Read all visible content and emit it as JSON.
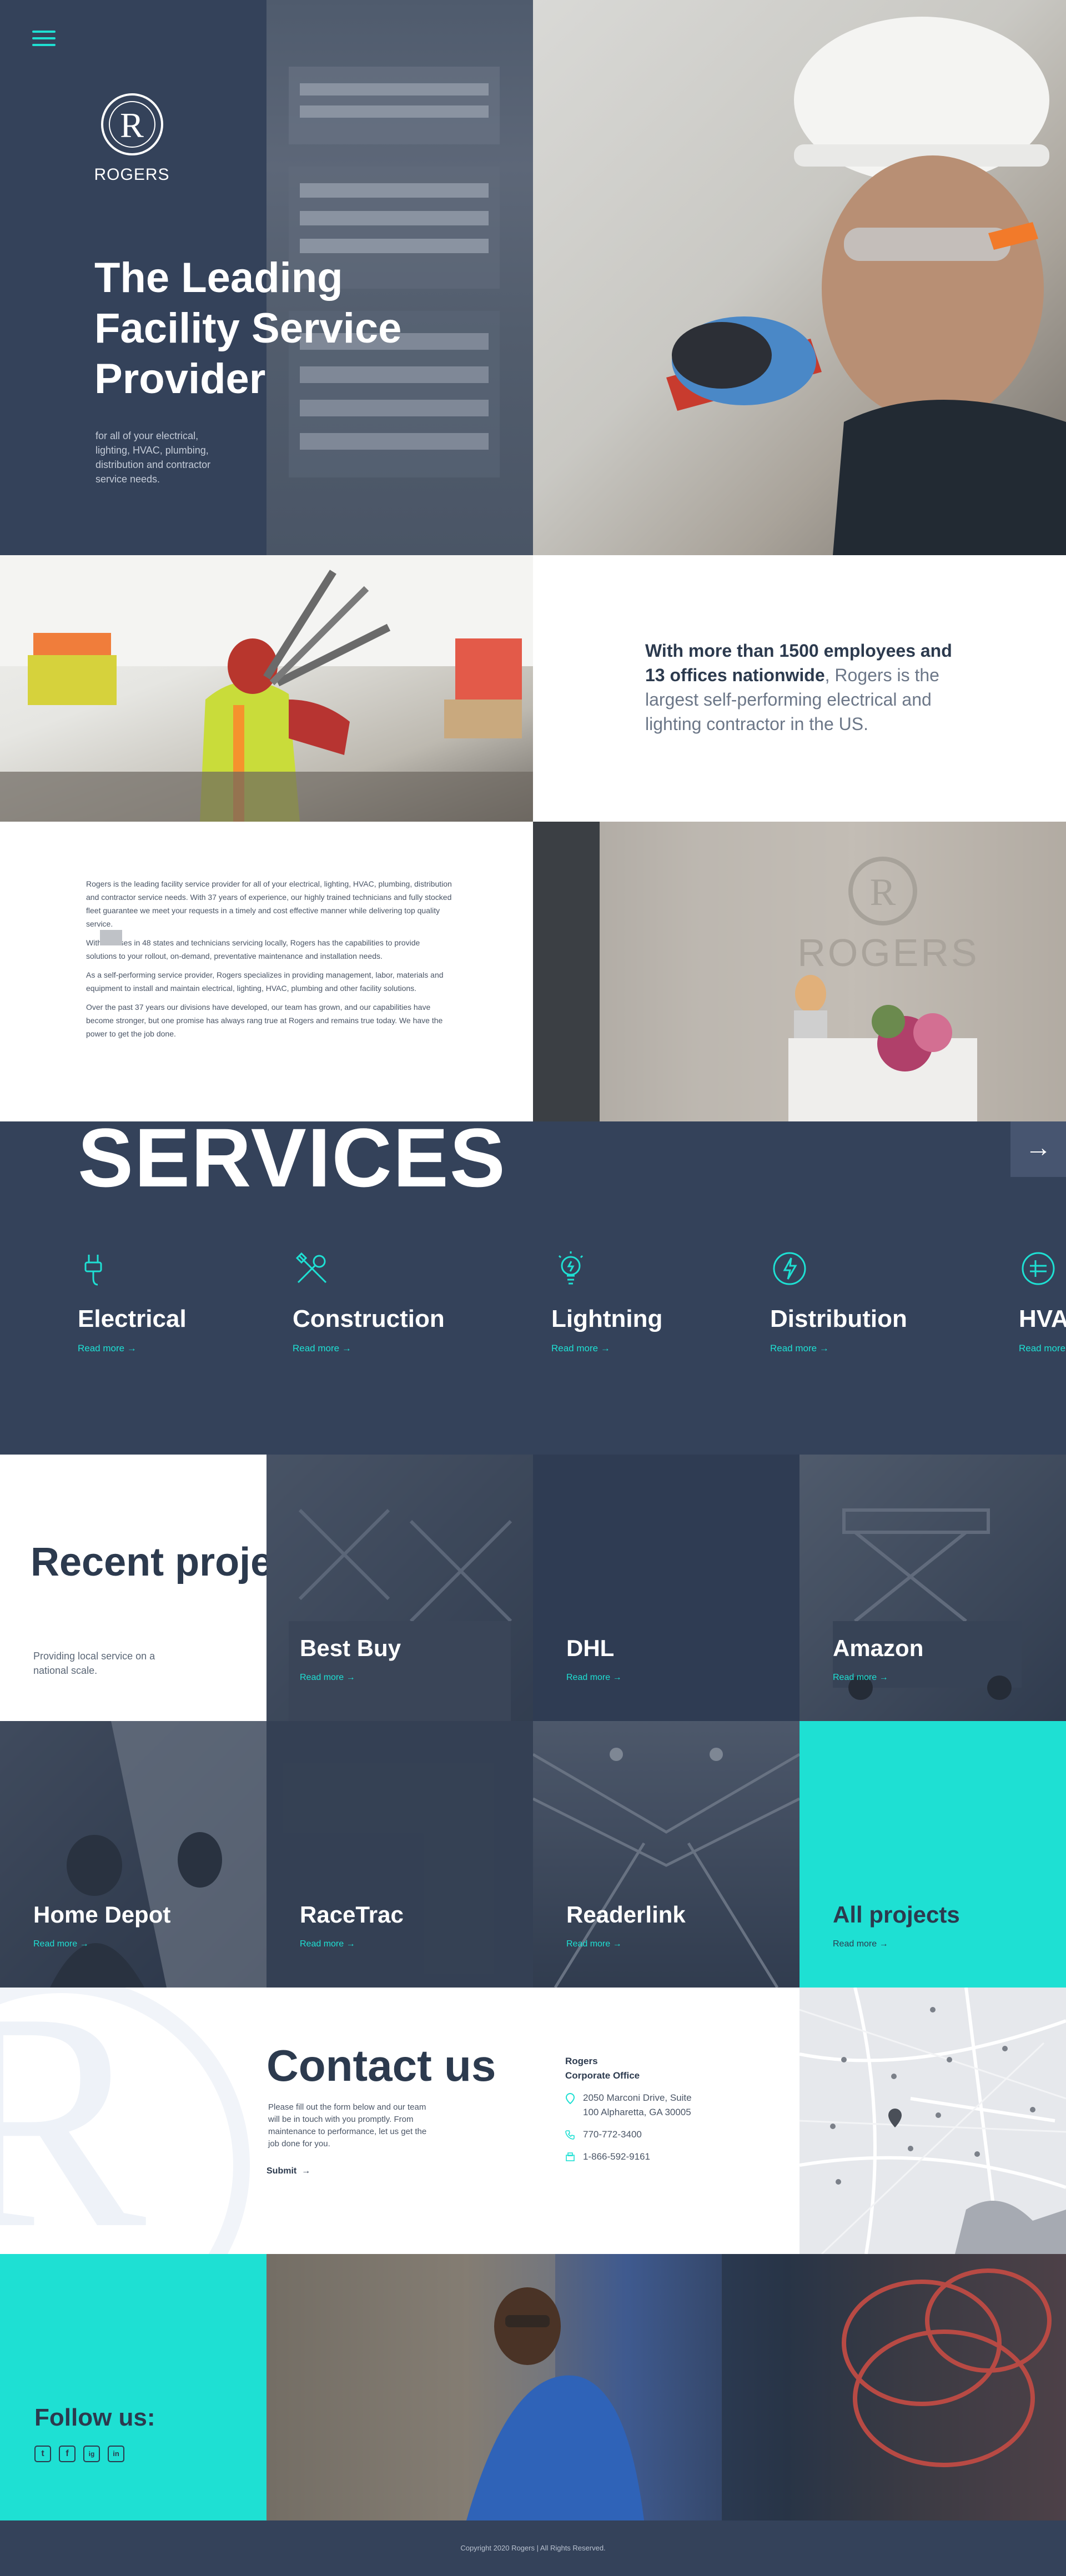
{
  "brand": {
    "name": "ROGERS",
    "initial": "R"
  },
  "hero": {
    "title": "The Leading Facility Service Provider",
    "subtitle": "for all of your electrical, lighting, HVAC, plumbing, distribution and contractor service needs."
  },
  "intro": {
    "bold": "With more than 1500 employees and 13 offices nationwide",
    "rest": ", Rogers is the largest self-performing electrical and lighting contractor in the US."
  },
  "about": {
    "paragraphs": [
      "Rogers is the leading facility service provider for all of your electrical, lighting, HVAC, plumbing, distribution and contractor service needs. With 37 years of experience, our highly trained technicians and fully stocked fleet guarantee we meet your requests in a timely and cost effective manner while delivering top quality service.",
      "With licenses in 48 states and technicians servicing locally, Rogers has the capabilities to provide solutions to your rollout, on-demand, preventative maintenance and installation needs.",
      "As a self-performing service provider, Rogers specializes in providing management, labor, materials and equipment to install and maintain electrical, lighting, HVAC, plumbing and other facility solutions.",
      "Over the past 37 years our divisions have developed, our team has grown, and our capabilities have become stronger, but one promise has always rang true at Rogers and remains true today. We have the power to get the job done."
    ]
  },
  "services": {
    "title": "SERVICES",
    "read_more": "Read more",
    "items": [
      {
        "label": "Electrical",
        "icon": "plug-icon"
      },
      {
        "label": "Construction",
        "icon": "tools-icon"
      },
      {
        "label": "Lightning",
        "icon": "lightbulb-icon"
      },
      {
        "label": "Distribution",
        "icon": "bolt-icon"
      },
      {
        "label": "HVAC",
        "icon": "hvac-icon"
      }
    ]
  },
  "projects": {
    "title": "Recent projects",
    "subtitle": "Providing local service on a national scale.",
    "read_more": "Read more",
    "items": [
      "Best Buy",
      "DHL",
      "Amazon",
      "Home Depot",
      "RaceTrac",
      "Readerlink"
    ],
    "all_label": "All projects"
  },
  "contact": {
    "title": "Contact us",
    "text": "Please fill out the form below and our team will be in touch with you promptly. From maintenance to performance, let us get the job done for you.",
    "submit": "Submit",
    "office_name": "Rogers",
    "office_label": "Corporate Office",
    "address": "2050 Marconi Drive, Suite 100 Alpharetta, GA 30005",
    "phone": "770-772-3400",
    "fax": "1-866-592-9161"
  },
  "follow": {
    "title": "Follow us:",
    "icons": [
      "t",
      "f",
      "ig",
      "in"
    ]
  },
  "footer": {
    "copyright": "Copyright 2020 Rogers | All Rights Reserved."
  },
  "colors": {
    "navy": "#34425a",
    "teal": "#1ee0d3",
    "text": "#2c3a4e"
  }
}
